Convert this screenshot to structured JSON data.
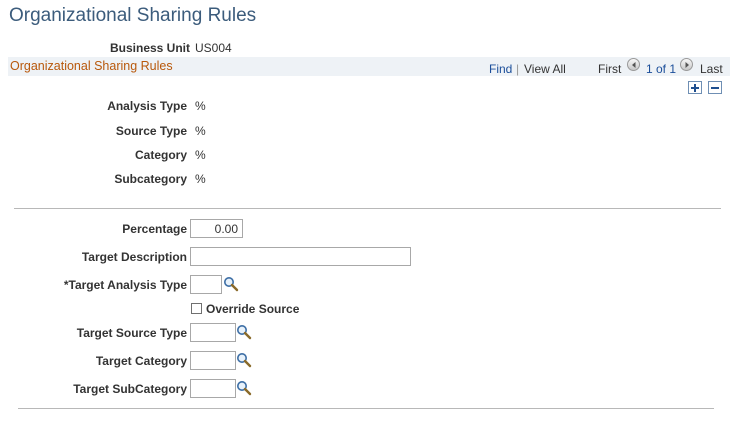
{
  "page": {
    "title": "Organizational Sharing Rules",
    "business_unit_label": "Business Unit",
    "business_unit_value": "US004"
  },
  "grid": {
    "title": "Organizational Sharing Rules",
    "find": "Find",
    "separator": "|",
    "view_all": "View All",
    "first": "First",
    "count": "1 of 1",
    "last": "Last"
  },
  "filters": [
    {
      "label": "Analysis Type",
      "value": "%"
    },
    {
      "label": "Source Type",
      "value": "%"
    },
    {
      "label": "Category",
      "value": "%"
    },
    {
      "label": "Subcategory",
      "value": "%"
    }
  ],
  "form": {
    "percentage_label": "Percentage",
    "percentage_value": "0.00",
    "target_description_label": "Target Description",
    "target_description_value": "",
    "target_analysis_type_label": "*Target Analysis Type",
    "target_analysis_type_value": "",
    "override_source_label": "Override Source",
    "override_source_checked": false,
    "target_source_type_label": "Target Source Type",
    "target_source_type_value": "",
    "target_category_label": "Target Category",
    "target_category_value": "",
    "target_subcategory_label": "Target SubCategory",
    "target_subcategory_value": ""
  },
  "icons": {
    "add_row": "plus-icon",
    "delete_row": "minus-icon",
    "lookup": "magnifier-icon",
    "prev": "chevron-left-icon",
    "next": "chevron-right-icon"
  },
  "colors": {
    "title": "#3c5c7c",
    "grid_title": "#b8580b",
    "link": "#1b4e9a",
    "grid_bar": "#eef2f6"
  }
}
